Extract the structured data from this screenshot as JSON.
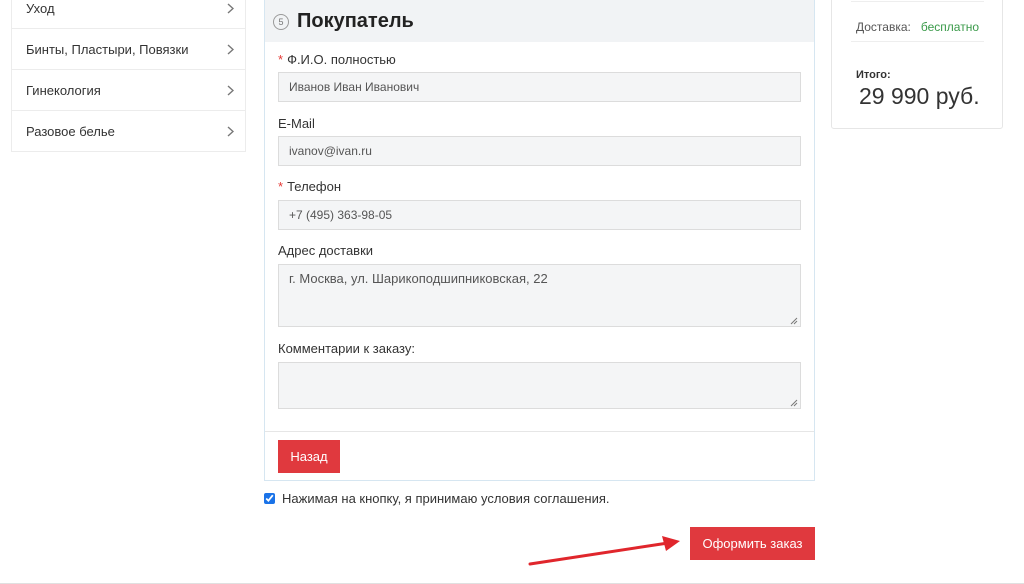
{
  "sidebar": {
    "items": [
      {
        "label": "Уход"
      },
      {
        "label": "Бинты, Пластыри, Повязки"
      },
      {
        "label": "Гинекология"
      },
      {
        "label": "Разовое белье"
      }
    ]
  },
  "buyer": {
    "step_number": "5",
    "title": "Покупатель",
    "required_mark": "*",
    "fields": {
      "fio": {
        "label": "Ф.И.О. полностью",
        "value": "Иванов Иван Иванович"
      },
      "email": {
        "label": "E-Mail",
        "value": "ivanov@ivan.ru"
      },
      "phone": {
        "label": "Телефон",
        "value": "+7 (495) 363-98-05"
      },
      "address": {
        "label": "Адрес доставки",
        "value": "г. Москва, ул. Шарикоподшипниковская, 22"
      },
      "comment": {
        "label": "Комментарии к заказу:",
        "value": ""
      }
    },
    "back_label": "Назад"
  },
  "agreement": {
    "checked": true,
    "text": "Нажимая на кнопку, я принимаю условия соглашения."
  },
  "order_button_label": "Оформить заказ",
  "summary": {
    "delivery_label": "Доставка:",
    "delivery_value": "бесплатно",
    "total_label": "Итого:",
    "total_value": "29 990 руб."
  },
  "colors": {
    "accent_red": "#e0393e",
    "free_green": "#3a9a4a",
    "panel_border": "#d6e6f1"
  },
  "icons": {
    "chevron": "chevron-right-icon",
    "arrow": "red-arrow-annotation"
  }
}
